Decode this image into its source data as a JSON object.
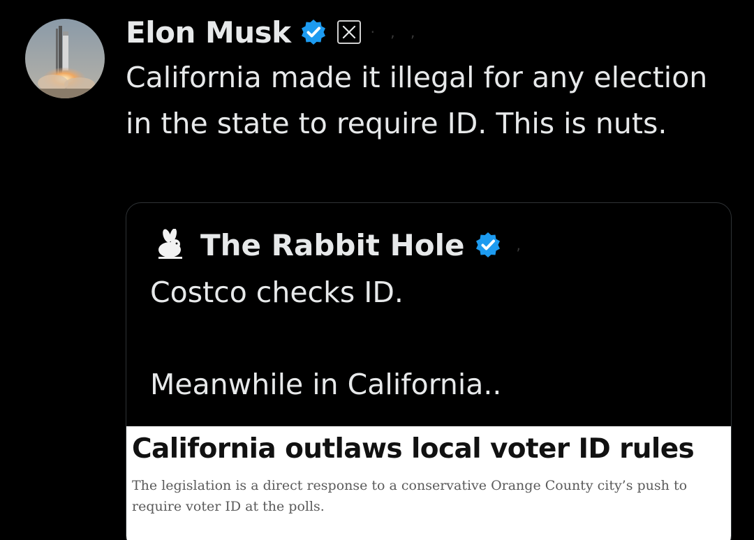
{
  "tweet": {
    "author": {
      "name": "Elon Musk",
      "handle": "· ,  ,",
      "avatar_icon": "starship-launch-avatar",
      "verified_icon": "verified-badge-icon",
      "affiliation_icon": "x-logo-icon"
    },
    "text": "California made it illegal for any election in the state to require ID. This is nuts."
  },
  "quote": {
    "author": {
      "name": "The Rabbit Hole",
      "handle": ",",
      "avatar_icon": "rabbit-icon",
      "verified_icon": "verified-badge-icon"
    },
    "line1": "Costco checks ID.",
    "line2": "Meanwhile in California..",
    "image": {
      "headline": "California outlaws local voter ID rules",
      "subhead": "The legislation is a direct response to a conservative Orange County city’s push to require voter ID at the polls."
    }
  },
  "colors": {
    "background": "#000000",
    "text": "#e7e9ea",
    "verified_blue": "#1d9bf0",
    "card_border": "#2f3336"
  }
}
